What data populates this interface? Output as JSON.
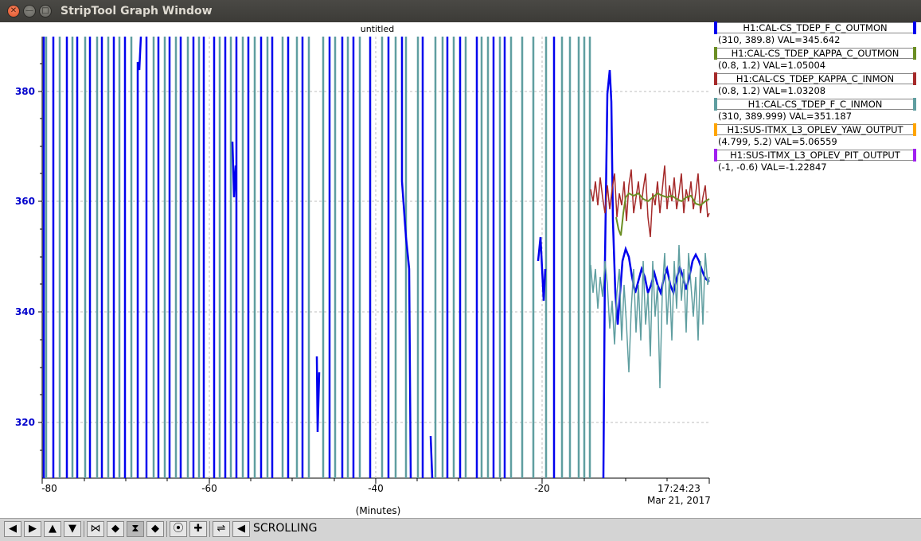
{
  "window": {
    "title": "StripTool Graph Window"
  },
  "graph": {
    "title": "untitled",
    "xlabel": "(Minutes)",
    "time": "17:24:23",
    "date": "Mar 21, 2017",
    "y_ticks": [
      "380",
      "360",
      "340",
      "320"
    ],
    "x_ticks": [
      "-80",
      "-60",
      "-40",
      "-20"
    ]
  },
  "legend": [
    {
      "name": "H1:CAL-CS_TDEP_F_C_OUTMON",
      "range": "(310, 389.8) VAL=345.642",
      "color": "#0000ee"
    },
    {
      "name": "H1:CAL-CS_TDEP_KAPPA_C_OUTMON",
      "range": "(0.8, 1.2) VAL=1.05004",
      "color": "#6b8e23"
    },
    {
      "name": "H1:CAL-CS_TDEP_KAPPA_C_INMON",
      "range": "(0.8, 1.2) VAL=1.03208",
      "color": "#a52a2a"
    },
    {
      "name": "H1:CAL-CS_TDEP_F_C_INMON",
      "range": "(310, 389.999) VAL=351.187",
      "color": "#5f9ea0"
    },
    {
      "name": "H1:SUS-ITMX_L3_OPLEV_YAW_OUTPUT",
      "range": "(4.799, 5.2) VAL=5.06559",
      "color": "#ffa500"
    },
    {
      "name": "H1:SUS-ITMX_L3_OPLEV_PIT_OUTPUT",
      "range": "(-1, -0.6) VAL=-1.22847",
      "color": "#a020f0"
    }
  ],
  "toolbar": {
    "status": "SCROLLING"
  },
  "icons": {
    "left": "◀",
    "right": "▶",
    "up": "▲",
    "down": "▼",
    "zoom_in_x": "⋈",
    "zoom_out_x": "◆",
    "zoom_in_y": "⧗",
    "zoom_out_y": "◆",
    "auto": "⦿",
    "plus": "✚",
    "refresh": "⇌",
    "back": "◀"
  }
}
